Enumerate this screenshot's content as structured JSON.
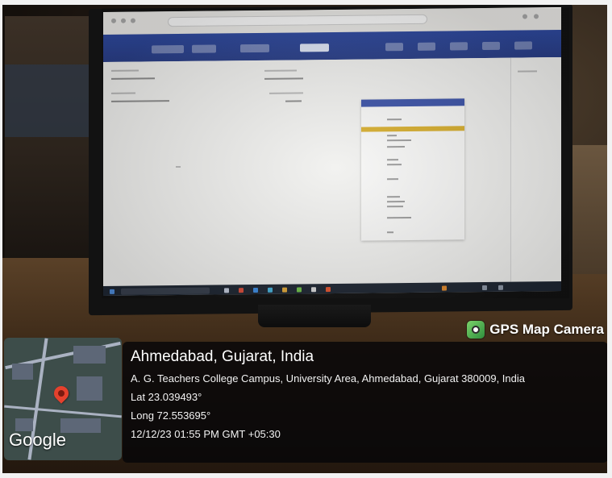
{
  "overlay": {
    "app_name": "GPS Map Camera",
    "location_title": "Ahmedabad, Gujarat, India",
    "address": "A. G. Teachers College Campus, University Area, Ahmedabad, Gujarat 380009, India",
    "latitude": "Lat 23.039493°",
    "longitude": "Long 72.553695°",
    "datetime": "12/12/23 01:55 PM GMT +05:30",
    "map_attribution": "Google",
    "icon": "gps-camera-icon",
    "pin_icon": "map-pin-icon",
    "accent_color": "#e5412d"
  },
  "scene": {
    "subject": "monitor-displaying-web-application",
    "header_color": "#2f4aa0",
    "highlight_color": "#d7ae2e"
  }
}
